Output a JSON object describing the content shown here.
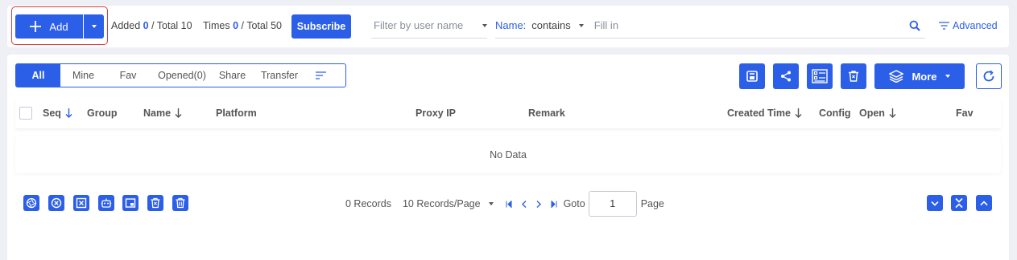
{
  "topbar": {
    "add_label": "Add",
    "added_label": "Added",
    "added_count": "0",
    "added_total": "/ Total 10",
    "times_label": "Times",
    "times_count": "0",
    "times_total": "/ Total 50",
    "subscribe_label": "Subscribe",
    "filter_user_placeholder": "Filter by user name",
    "name_label": "Name:",
    "name_operator": "contains",
    "fill_placeholder": "Fill in",
    "advanced_label": "Advanced"
  },
  "tabs": [
    {
      "label": "All",
      "active": true
    },
    {
      "label": "Mine"
    },
    {
      "label": "Fav"
    },
    {
      "label": "Opened(0)"
    },
    {
      "label": "Share"
    },
    {
      "label": "Transfer"
    }
  ],
  "toolbar": {
    "more_label": "More"
  },
  "table": {
    "columns": [
      {
        "label": "Seq",
        "sortable": true
      },
      {
        "label": "Group"
      },
      {
        "label": "Name",
        "sortable": true
      },
      {
        "label": "Platform"
      },
      {
        "label": "Proxy IP"
      },
      {
        "label": "Remark"
      },
      {
        "label": "Created Time",
        "sortable": true
      },
      {
        "label": "Config"
      },
      {
        "label": "Open",
        "sortable": true
      },
      {
        "label": "Fav"
      }
    ],
    "empty_text": "No Data"
  },
  "pager": {
    "records": "0 Records",
    "page_size": "10 Records/Page",
    "goto_label": "Goto",
    "goto_value": "1",
    "page_label": "Page"
  },
  "colors": {
    "primary": "#2c5fe8",
    "highlight": "#e03a3a",
    "background": "#eef0f5"
  }
}
